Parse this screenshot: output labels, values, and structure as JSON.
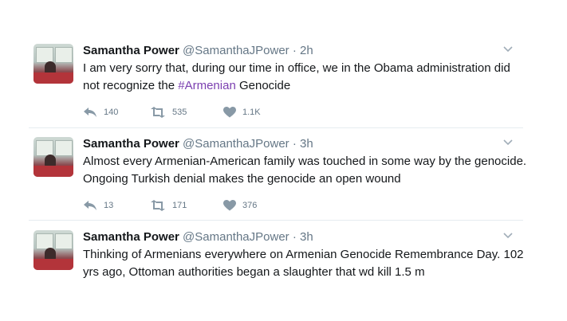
{
  "tweets": [
    {
      "name": "Samantha Power",
      "handle": "@SamanthaJPower",
      "separator": "·",
      "time": "2h",
      "text_before": "I am very sorry that, during our time in office, we in the Obama administration did not recognize the ",
      "hashtag": "#Armenian",
      "text_after": " Genocide",
      "replies": "140",
      "retweets": "535",
      "likes": "1.1K"
    },
    {
      "name": "Samantha Power",
      "handle": "@SamanthaJPower",
      "separator": "·",
      "time": "3h",
      "text_before": "Almost every Armenian-American family was touched in some way by the genocide. Ongoing Turkish denial makes the genocide an open wound",
      "hashtag": "",
      "text_after": "",
      "replies": "13",
      "retweets": "171",
      "likes": "376"
    },
    {
      "name": "Samantha Power",
      "handle": "@SamanthaJPower",
      "separator": "·",
      "time": "3h",
      "text_before": "Thinking of Armenians everywhere on Armenian Genocide Remembrance Day. 102 yrs ago, Ottoman authorities began a slaughter that wd kill 1.5 m",
      "hashtag": "",
      "text_after": ""
    }
  ],
  "icons": {
    "reply": "reply-icon",
    "retweet": "retweet-icon",
    "like": "heart-icon",
    "menu": "chevron-down-icon"
  },
  "colors": {
    "hashtag": "#7b3fb0",
    "secondary": "#657786",
    "divider": "#e6ecf0"
  }
}
